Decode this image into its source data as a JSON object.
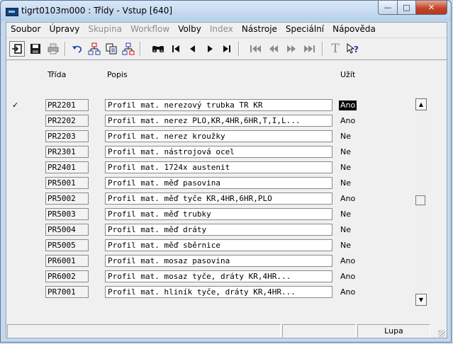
{
  "window": {
    "title": "tigrt0103m000 : Třídy - Vstup [640]"
  },
  "window_buttons": {
    "minimize": "—",
    "maximize": "□",
    "close": "✕"
  },
  "menu": [
    {
      "label": "Soubor",
      "enabled": true
    },
    {
      "label": "Úpravy",
      "enabled": true
    },
    {
      "label": "Skupina",
      "enabled": false
    },
    {
      "label": "Workflow",
      "enabled": false
    },
    {
      "label": "Volby",
      "enabled": true
    },
    {
      "label": "Index",
      "enabled": false
    },
    {
      "label": "Nástroje",
      "enabled": true
    },
    {
      "label": "Speciální",
      "enabled": true
    },
    {
      "label": "Nápověda",
      "enabled": true
    }
  ],
  "toolbar": {
    "icons": [
      "exit-icon",
      "save-icon",
      "print-icon",
      "undo-icon",
      "insert-record-icon",
      "copy-record-icon",
      "delete-record-icon",
      "find-icon",
      "first-record-icon",
      "previous-record-icon",
      "next-record-icon",
      "last-record-icon",
      "first-group-icon",
      "previous-group-icon",
      "next-group-icon",
      "last-group-icon",
      "text-icon",
      "context-help-icon"
    ],
    "glyphs": {
      "text": "T",
      "help": "?",
      "find": "🔭"
    }
  },
  "table": {
    "headers": {
      "code": "Třída",
      "description": "Popis",
      "use": "Užít"
    },
    "current_row_marker": "✓",
    "rows": [
      {
        "code": "PR2201",
        "description": "Profil mat. nerezový trubka TR KR",
        "use": "Ano",
        "current": true
      },
      {
        "code": "PR2202",
        "description": "Profil mat. nerez PLO,KR,4HR,6HR,T,I,L...",
        "use": "Ano"
      },
      {
        "code": "PR2203",
        "description": "Profil mat. nerez kroužky",
        "use": "Ne"
      },
      {
        "code": "PR2301",
        "description": "Profil mat. nástrojová ocel",
        "use": "Ne"
      },
      {
        "code": "PR2401",
        "description": "Profil mat. 1724x austenit",
        "use": "Ne"
      },
      {
        "code": "PR5001",
        "description": "Profil mat. měď pasovina",
        "use": "Ne"
      },
      {
        "code": "PR5002",
        "description": "Profil mat. měď tyče KR,4HR,6HR,PLO",
        "use": "Ano"
      },
      {
        "code": "PR5003",
        "description": "Profil mat. měď trubky",
        "use": "Ne"
      },
      {
        "code": "PR5004",
        "description": "Profil mat. měď dráty",
        "use": "Ne"
      },
      {
        "code": "PR5005",
        "description": "Profil mat. měď sběrnice",
        "use": "Ne"
      },
      {
        "code": "PR6001",
        "description": "Profil mat. mosaz pasovina",
        "use": "Ano"
      },
      {
        "code": "PR6002",
        "description": "Profil mat. mosaz tyče, dráty KR,4HR...",
        "use": "Ano"
      },
      {
        "code": "PR7001",
        "description": "Profil mat. hliník tyče, dráty KR,4HR...",
        "use": "Ano"
      }
    ]
  },
  "scrollbar": {
    "up": "▲",
    "down": "▼"
  },
  "status": {
    "panel1": "",
    "panel2": "",
    "panel3": "Lupa"
  }
}
